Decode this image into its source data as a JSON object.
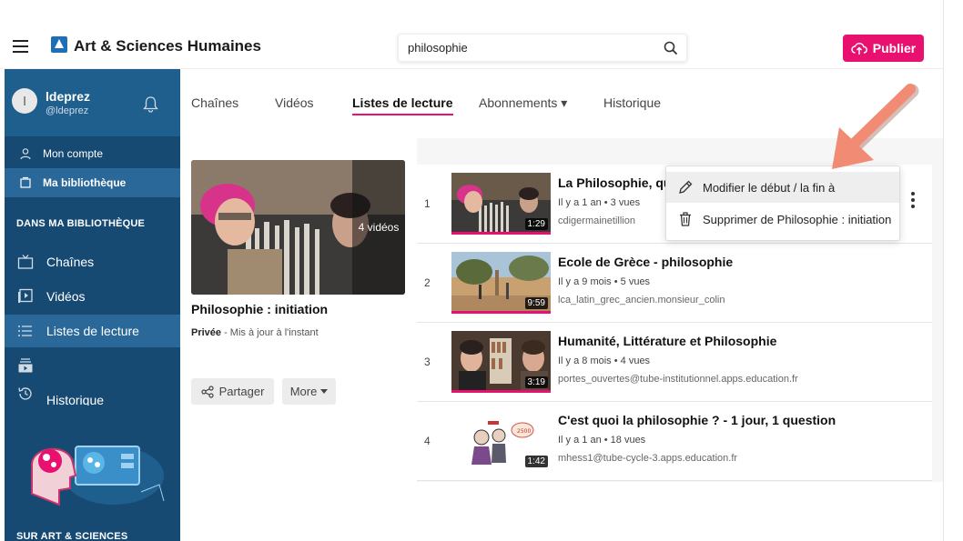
{
  "header": {
    "site_title": "Art & Sciences Humaines",
    "search_value": "philosophie",
    "publish_label": "Publier"
  },
  "sidebar": {
    "user": {
      "initial": "l",
      "name": "ldeprez",
      "handle": "@ldeprez"
    },
    "account_items": [
      {
        "label": "Mon compte",
        "icon": "user-icon"
      },
      {
        "label": "Ma bibliothèque",
        "icon": "library-icon",
        "active": true
      }
    ],
    "library_section_title": "DANS MA BIBLIOTHÈQUE",
    "library_items": [
      {
        "label": "Chaînes",
        "icon": "tv-icon"
      },
      {
        "label": "Vidéos",
        "icon": "video-icon"
      },
      {
        "label": "Listes de lecture",
        "icon": "list-icon",
        "active": true
      },
      {
        "label": "",
        "icon": "subscriptions-icon"
      },
      {
        "label": "Historique",
        "icon": "history-icon"
      }
    ],
    "footer_section_title": "SUR ART & SCIENCES HUMAINES"
  },
  "tabs": [
    {
      "label": "Chaînes"
    },
    {
      "label": "Vidéos"
    },
    {
      "label": "Listes de lecture",
      "active": true
    },
    {
      "label": "Abonnements ▾"
    },
    {
      "label": "Historique"
    }
  ],
  "playlist": {
    "video_count": "4 vidéos",
    "title": "Philosophie : initiation",
    "privacy": "Privée",
    "updated": " - Mis à jour à l'instant",
    "share_label": "Partager",
    "more_label": "More"
  },
  "videos": [
    {
      "index": "1",
      "title": "La Philosophie, qu",
      "meta": "Il y a 1 an • 3 vues",
      "channel": "cdigermainetillion",
      "duration": "1:29"
    },
    {
      "index": "2",
      "title": "Ecole de Grèce - philosophie",
      "meta": "Il y a 9 mois • 5 vues",
      "channel": "lca_latin_grec_ancien.monsieur_colin",
      "duration": "9:59"
    },
    {
      "index": "3",
      "title": "Humanité, Littérature et Philosophie",
      "meta": "Il y a 8 mois • 4 vues",
      "channel": "portes_ouvertes@tube-institutionnel.apps.education.fr",
      "duration": "3:19"
    },
    {
      "index": "4",
      "title": "C'est quoi la philosophie ? - 1 jour, 1 question",
      "meta": "Il y a 1 an • 18 vues",
      "channel": "mhess1@tube-cycle-3.apps.education.fr",
      "duration": "1:42"
    }
  ],
  "context_menu": {
    "items": [
      {
        "label": "Modifier le début / la fin à",
        "icon": "pencil-icon"
      },
      {
        "label": "Supprimer de Philosophie : initiation",
        "icon": "trash-icon"
      }
    ]
  },
  "colors": {
    "accent": "#e8116f",
    "sidebar": "#174a73",
    "annotation_arrow": "#f28b74"
  }
}
